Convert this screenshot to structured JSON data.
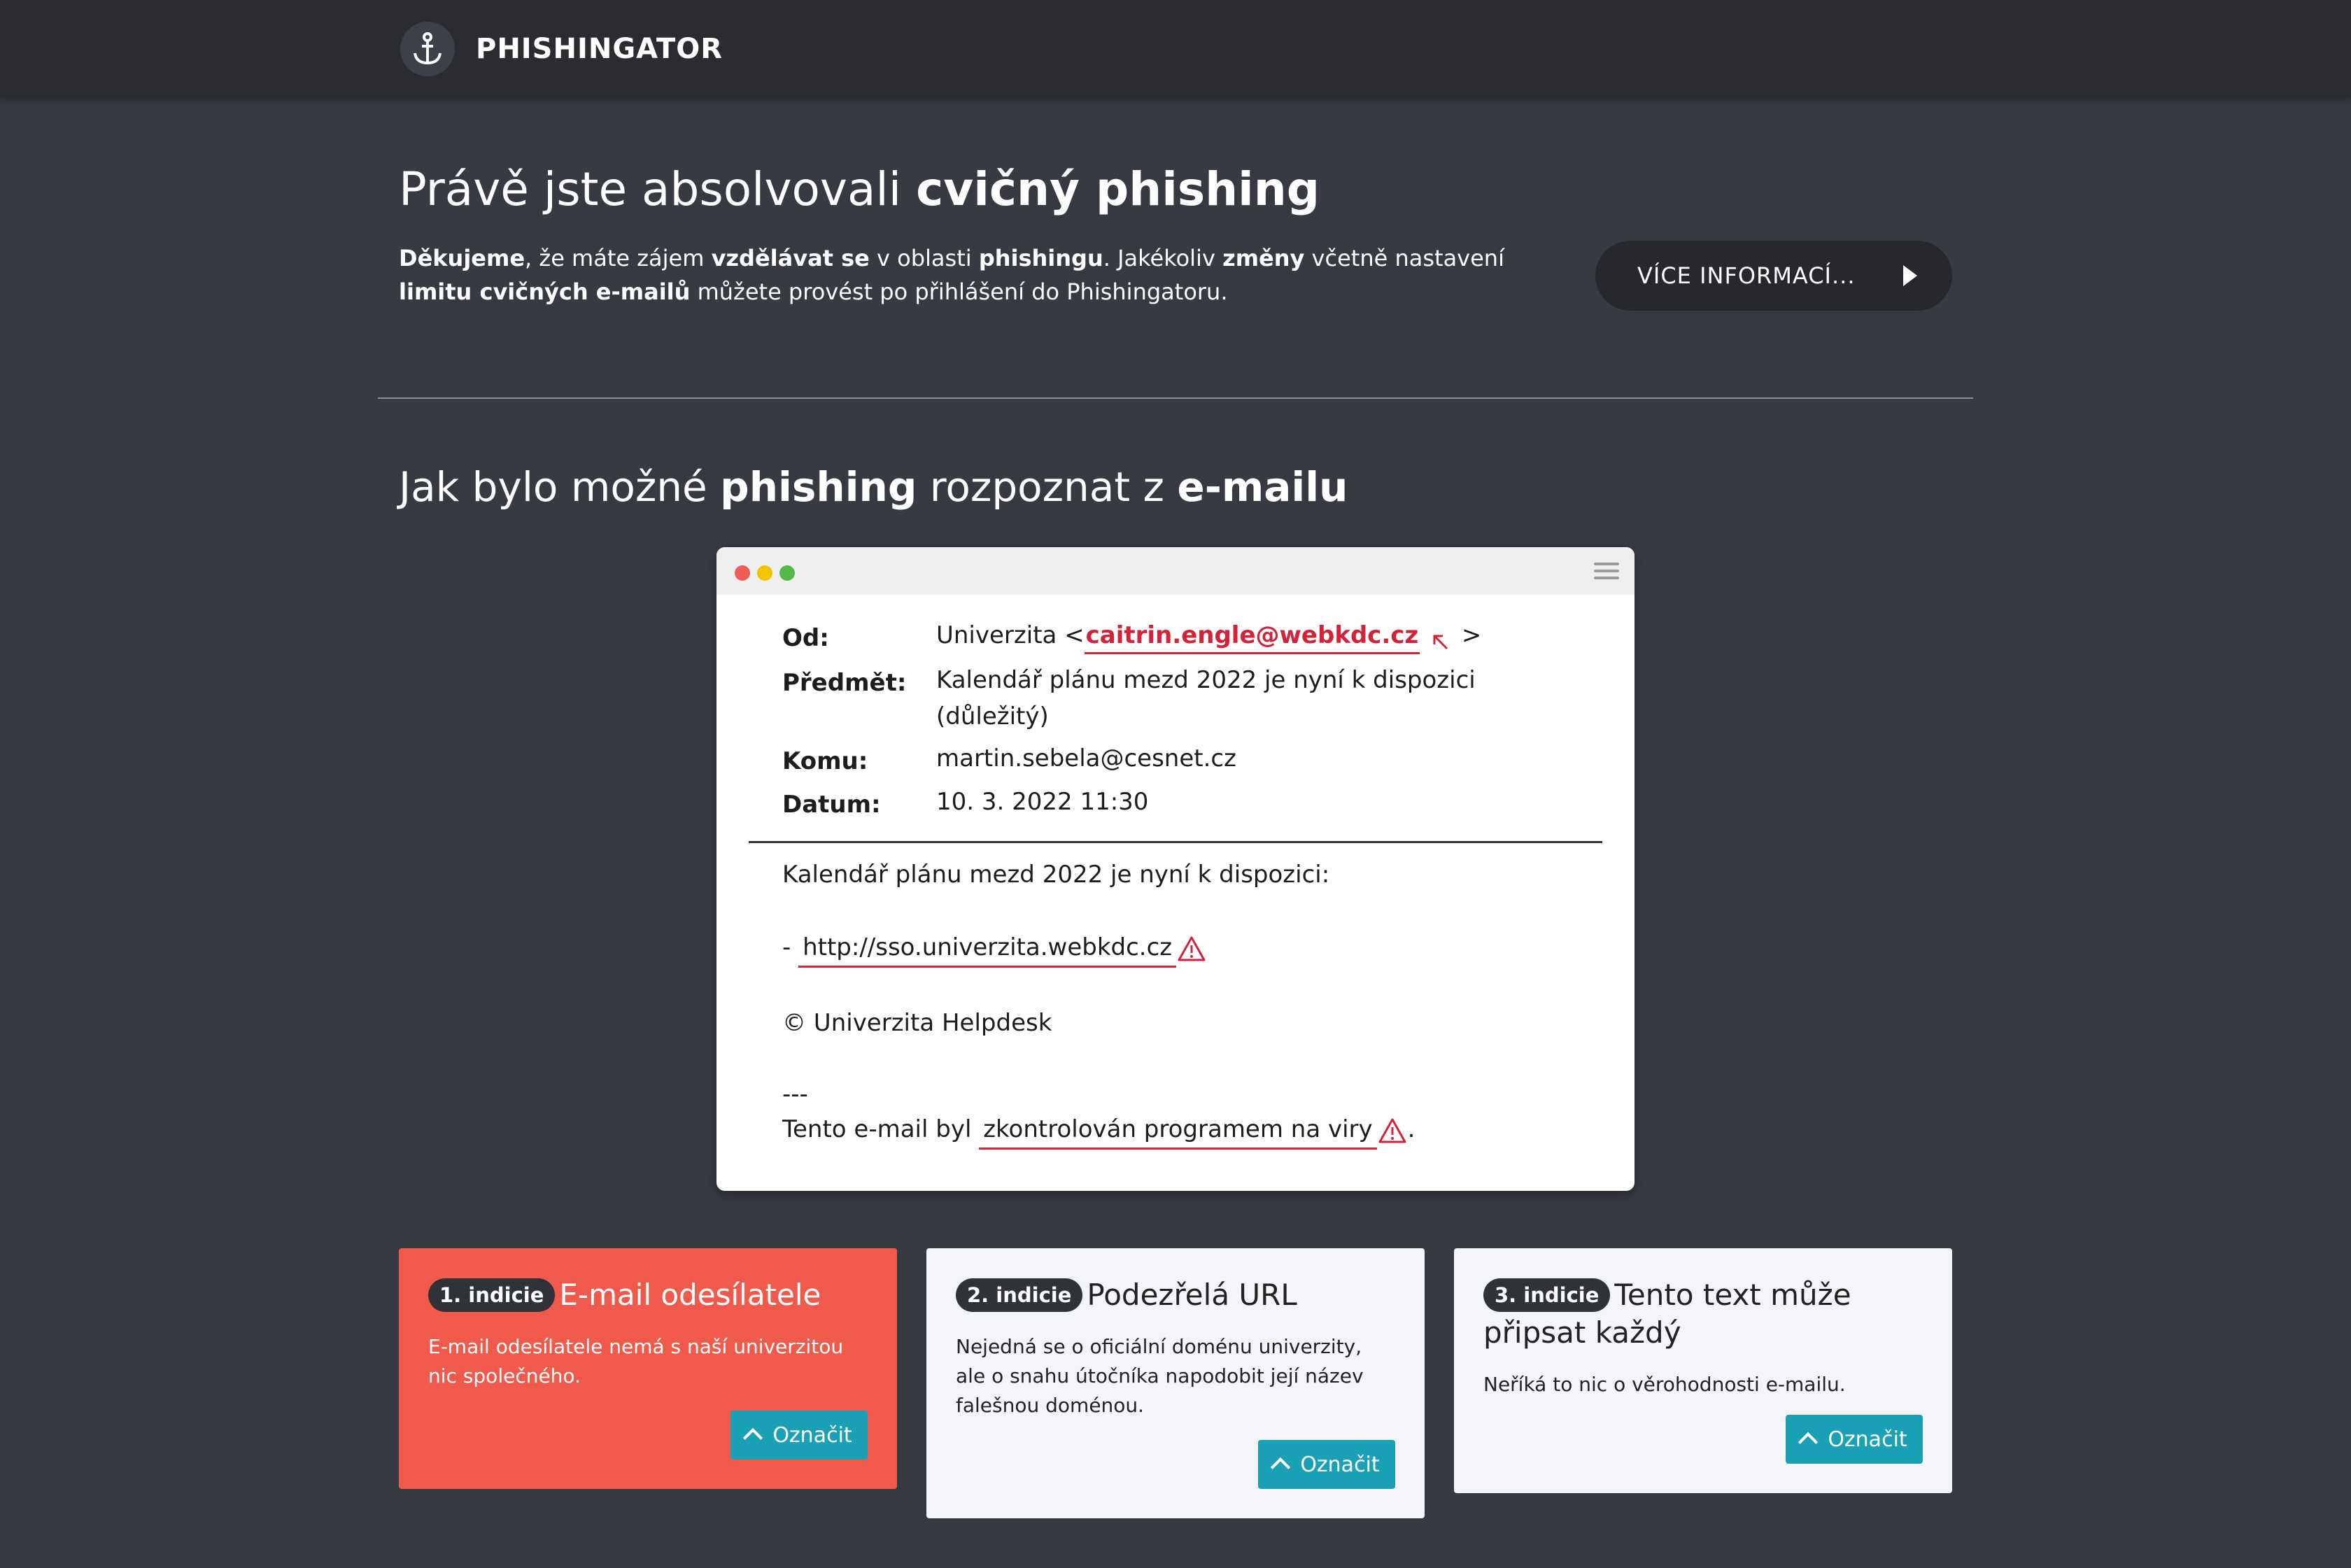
{
  "navbar": {
    "brand": "PHISHINGATOR",
    "logo_icon": "anchor-icon"
  },
  "hero": {
    "title_regular": "Právě jste absolvovali ",
    "title_bold": "cvičný phishing",
    "text": {
      "p1": "Děkujeme",
      "p2": ", že máte zájem ",
      "p3": "vzdělávat se",
      "p4": " v oblasti ",
      "p5": "phishingu",
      "p6": ". Jakékoliv ",
      "p7": "změny",
      "p8": " včetně nastavení ",
      "p9": "limitu cvičných e-mailů",
      "p10": " můžete provést po přihlášení do Phishingatoru."
    },
    "more_button": "VÍCE INFORMACÍ..."
  },
  "section": {
    "t1": "Jak bylo možné ",
    "t2": "phishing",
    "t3": " rozpoznat z ",
    "t4": "e-mailu"
  },
  "email": {
    "labels": {
      "from": "Od:",
      "subject": "Předmět:",
      "to": "Komu:",
      "date": "Datum:"
    },
    "from_name": "Univerzita <",
    "from_address": "caitrin.engle@webkdc.cz",
    "from_close": ">",
    "subject_line1": "Kalendář plánu mezd 2022 je nyní k dispozici",
    "subject_line2": "(důležitý)",
    "to": "martin.sebela@cesnet.cz",
    "date": "10. 3. 2022 11:30",
    "body_intro": "Kalendář plánu mezd 2022 je nyní k dispozici:",
    "body_dash": "-",
    "body_link": "http://sso.univerzita.webkdc.cz",
    "body_signature": "© Univerzita Helpdesk",
    "body_separator": "---",
    "body_footer_pre": "Tento e-mail byl",
    "body_footer_link": "zkontrolován programem na viry",
    "body_footer_post": "."
  },
  "cards": [
    {
      "badge": "1. indicie",
      "title": "E-mail odesílatele",
      "text": "E-mail odesílatele nemá s naší univerzitou nic společného.",
      "button": "Označit"
    },
    {
      "badge": "2. indicie",
      "title": "Podezřelá URL",
      "text": "Nejedná se o oficiální doménu univerzity, ale o snahu útočníka napodobit její název falešnou doménou.",
      "button": "Označit"
    },
    {
      "badge": "3. indicie",
      "title": "Tento text může připsat každý",
      "text": "Neříká to nic o věrohodnosti e-mailu.",
      "button": "Označit"
    }
  ],
  "colors": {
    "accent_red": "#ef5a4c",
    "link_red": "#d2233a",
    "button_teal": "#1aa1b6"
  }
}
